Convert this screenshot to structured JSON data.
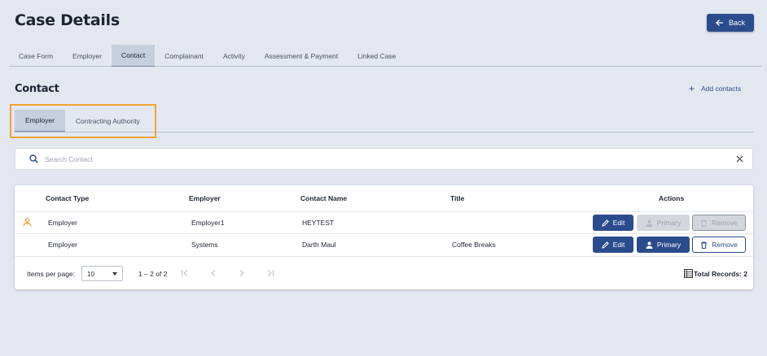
{
  "header": {
    "title": "Case Details",
    "back_label": "Back"
  },
  "main_tabs": [
    {
      "label": "Case Form"
    },
    {
      "label": "Employer"
    },
    {
      "label": "Contact",
      "active": true
    },
    {
      "label": "Complainant"
    },
    {
      "label": "Activity"
    },
    {
      "label": "Assessment & Payment"
    },
    {
      "label": "Linked Case"
    }
  ],
  "section": {
    "title": "Contact",
    "add_label": "Add contacts"
  },
  "sub_tabs": [
    {
      "label": "Employer",
      "active": true
    },
    {
      "label": "Contracting Authority"
    }
  ],
  "search": {
    "placeholder": "Search Contact",
    "value": ""
  },
  "table": {
    "columns": [
      "Contact Type",
      "Employer",
      "Contact Name",
      "Title",
      "Actions"
    ],
    "rows": [
      {
        "contact_type": "Employer",
        "employer": "Employer1",
        "contact_name": "HEYTEST",
        "title": "",
        "is_primary": true
      },
      {
        "contact_type": "Employer",
        "employer": "Systems",
        "contact_name": "Darth Maul",
        "title": "Coffee Breaks",
        "is_primary": false
      }
    ],
    "actions": {
      "edit": "Edit",
      "primary": "Primary",
      "remove": "Remove"
    }
  },
  "paginator": {
    "items_per_page_label": "Items per page:",
    "items_per_page": "10",
    "range": "1 – 2 of 2",
    "total_label": "Total Records: 2"
  },
  "colors": {
    "accent": "#2b4c8c",
    "highlight": "#f0a534",
    "primary_icon": "#f0a534"
  }
}
